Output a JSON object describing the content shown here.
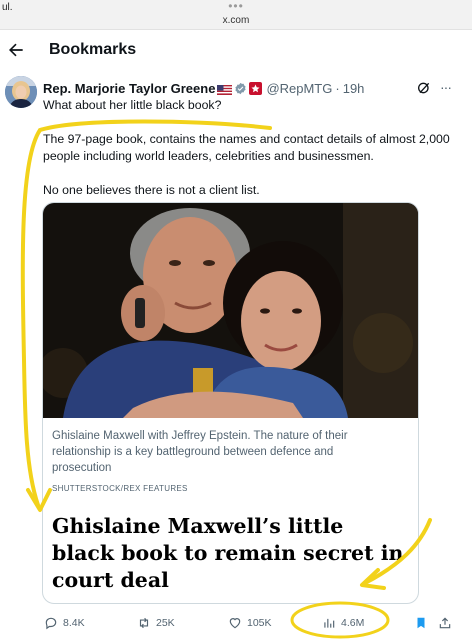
{
  "browser": {
    "carrier": "ul.",
    "menu_dots": "•••",
    "url": "x.com"
  },
  "header": {
    "title": "Bookmarks"
  },
  "tweet": {
    "author_name": "Rep. Marjorie Taylor Greene",
    "handle": "@RepMTG",
    "separator": "·",
    "time": "19h",
    "more": "···",
    "text_line1": "What about her little black book?",
    "text_para2": "The 97-page book, contains the names and contact details of almost 2,000 people including world leaders, celebrities and businessmen.",
    "text_para3": "No one believes there is not a client list."
  },
  "card": {
    "caption": "Ghislaine Maxwell with Jeffrey Epstein. The nature of their relationship is a key battleground between defence and prosecution",
    "credit": "SHUTTERSTOCK/REX FEATURES",
    "headline": "Ghislaine Maxwell’s little black book to remain secret in court deal"
  },
  "actions": {
    "replies": "8.4K",
    "reposts": "25K",
    "likes": "105K",
    "views": "4.6M"
  },
  "colors": {
    "accent": "#1d9bf0",
    "muted": "#536471",
    "annotation": "#f2d21b",
    "bookmark": "#1d9bf0"
  },
  "icons": [
    "back-arrow-icon",
    "verified-badge-icon",
    "us-flag-icon",
    "affiliate-badge-icon",
    "grok-icon",
    "more-icon",
    "reply-icon",
    "repost-icon",
    "like-icon",
    "views-icon",
    "bookmark-icon",
    "share-icon"
  ]
}
